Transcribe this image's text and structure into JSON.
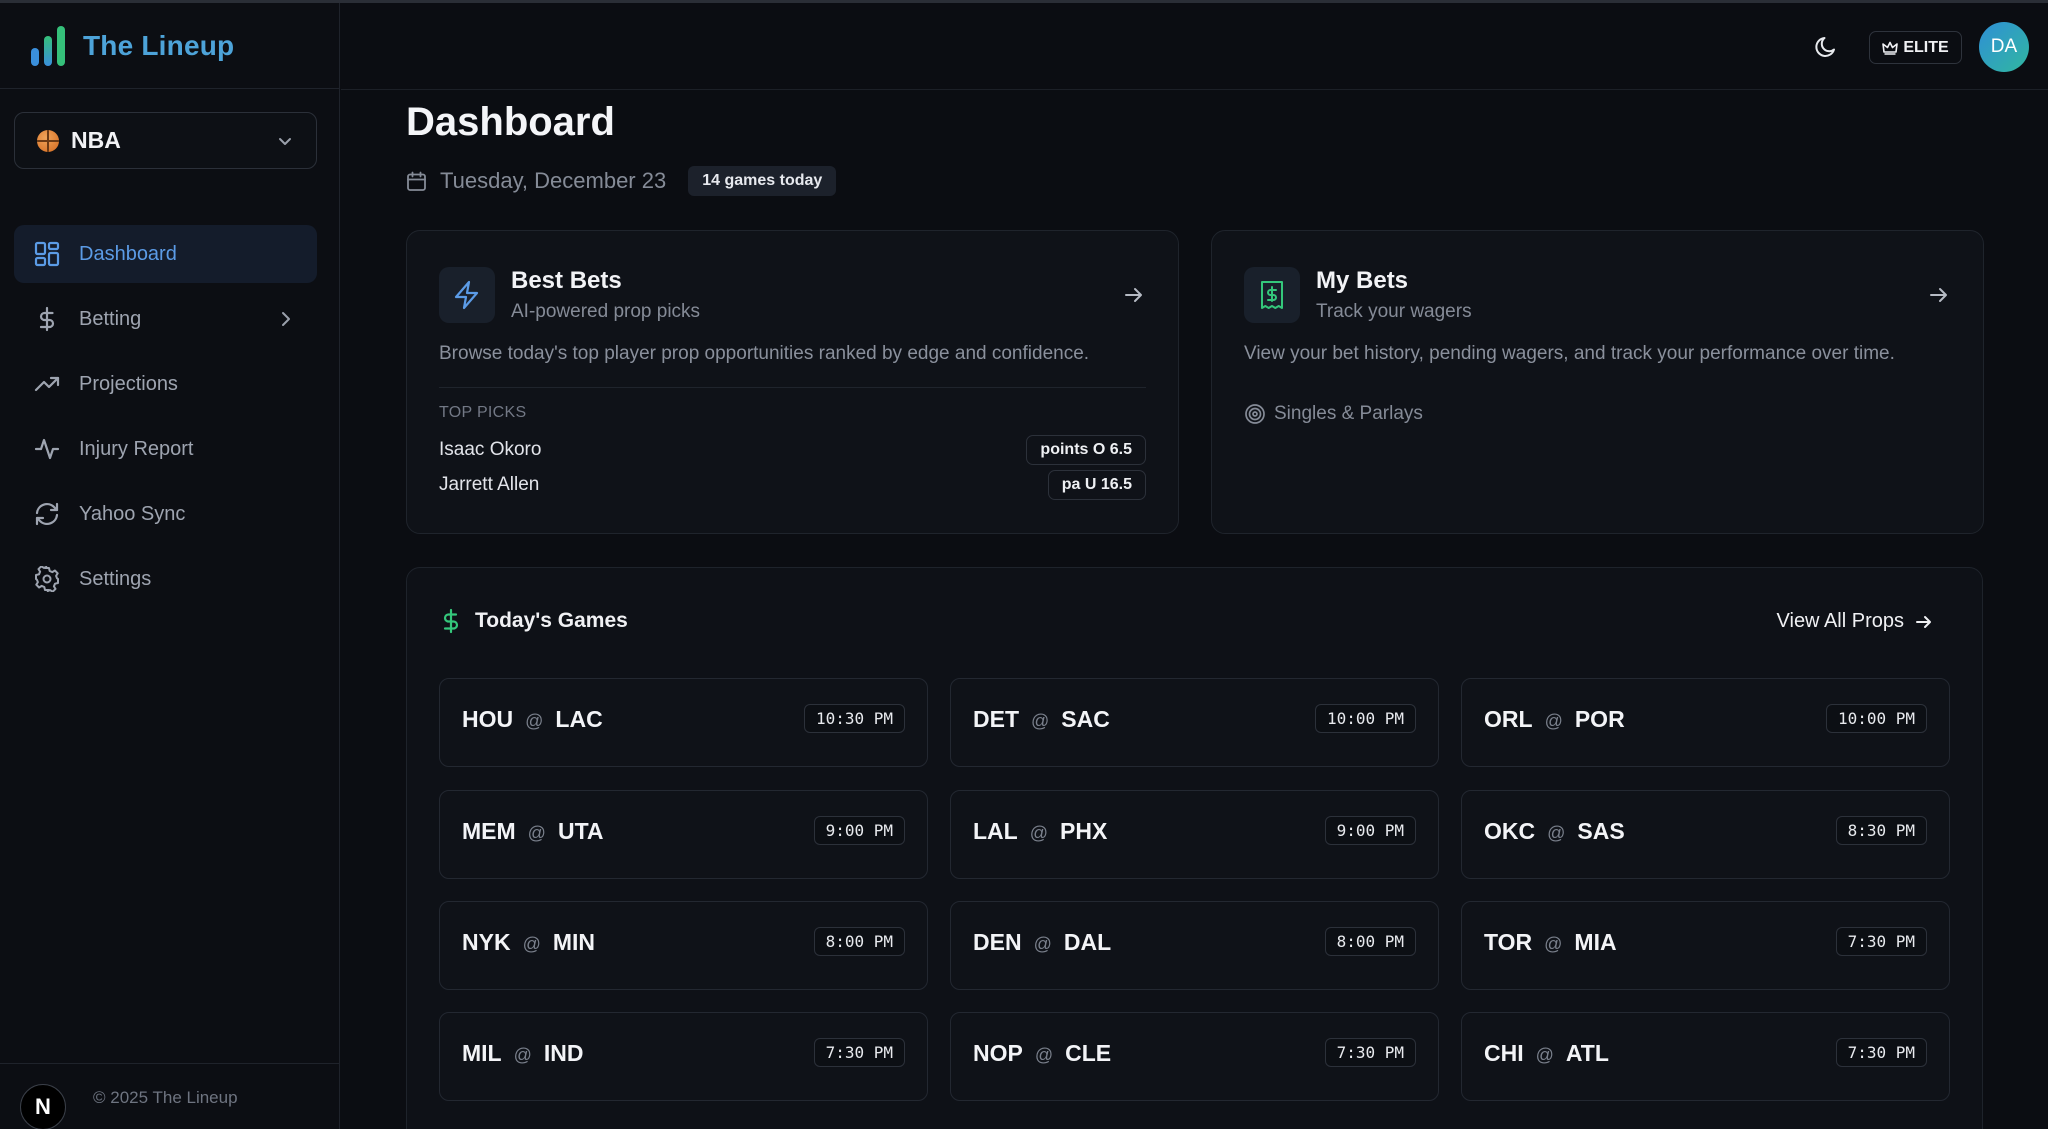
{
  "brand": {
    "name": "The Lineup"
  },
  "league_selector": {
    "label": "NBA"
  },
  "nav": [
    {
      "label": "Dashboard",
      "icon": "dashboard-grid-icon",
      "active": true
    },
    {
      "label": "Betting",
      "icon": "dollar-icon",
      "has_submenu": true
    },
    {
      "label": "Projections",
      "icon": "trending-up-icon"
    },
    {
      "label": "Injury Report",
      "icon": "activity-pulse-icon"
    },
    {
      "label": "Yahoo Sync",
      "icon": "refresh-icon"
    },
    {
      "label": "Settings",
      "icon": "gear-icon"
    }
  ],
  "footer": {
    "badge": "N",
    "copyright": "© 2025 The Lineup"
  },
  "header": {
    "tier_label": "ELITE",
    "avatar_initials": "DA"
  },
  "page": {
    "title": "Dashboard",
    "date": "Tuesday, December 23",
    "games_badge": "14 games today"
  },
  "best_bets": {
    "title": "Best Bets",
    "subtitle": "AI-powered prop picks",
    "description": "Browse today's top player prop opportunities ranked by edge and confidence.",
    "top_picks_heading": "TOP PICKS",
    "picks": [
      {
        "player": "Isaac Okoro",
        "line": "points O 6.5"
      },
      {
        "player": "Jarrett Allen",
        "line": "pa U 16.5"
      }
    ]
  },
  "my_bets": {
    "title": "My Bets",
    "subtitle": "Track your wagers",
    "description": "View your bet history, pending wagers, and track your performance over time.",
    "tag": "Singles & Parlays"
  },
  "todays_games": {
    "title": "Today's Games",
    "view_all_label": "View All Props",
    "games": [
      {
        "away": "HOU",
        "home": "LAC",
        "time": "10:30 PM"
      },
      {
        "away": "DET",
        "home": "SAC",
        "time": "10:00 PM"
      },
      {
        "away": "ORL",
        "home": "POR",
        "time": "10:00 PM"
      },
      {
        "away": "MEM",
        "home": "UTA",
        "time": "9:00 PM"
      },
      {
        "away": "LAL",
        "home": "PHX",
        "time": "9:00 PM"
      },
      {
        "away": "OKC",
        "home": "SAS",
        "time": "8:30 PM"
      },
      {
        "away": "NYK",
        "home": "MIN",
        "time": "8:00 PM"
      },
      {
        "away": "DEN",
        "home": "DAL",
        "time": "8:00 PM"
      },
      {
        "away": "TOR",
        "home": "MIA",
        "time": "7:30 PM"
      },
      {
        "away": "MIL",
        "home": "IND",
        "time": "7:30 PM"
      },
      {
        "away": "NOP",
        "home": "CLE",
        "time": "7:30 PM"
      },
      {
        "away": "CHI",
        "home": "ATL",
        "time": "7:30 PM"
      }
    ]
  },
  "colors": {
    "accent_blue": "#5b9be6",
    "accent_green": "#34c77b",
    "background": "#0b0d12"
  }
}
